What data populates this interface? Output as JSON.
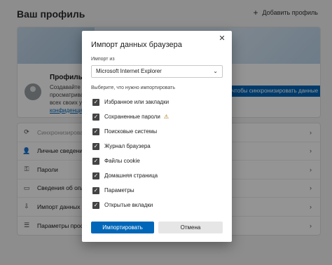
{
  "header": {
    "title": "Ваш профиль",
    "add_profile": "Добавить профиль"
  },
  "profile": {
    "name": "Профиль 1",
    "desc_lines": [
      "Создавайте",
      "просматрива",
      "всех своих у"
    ],
    "link": "конфиденци",
    "sync_button": "чтобы синхронизировать данные"
  },
  "settings": {
    "items": [
      {
        "label": "Синхронизироват",
        "icon": "sync-icon"
      },
      {
        "label": "Личные сведения",
        "icon": "person-icon"
      },
      {
        "label": "Пароли",
        "icon": "key-icon"
      },
      {
        "label": "Сведения об оплат",
        "icon": "card-icon"
      },
      {
        "label": "Импорт данных бр",
        "icon": "import-icon"
      },
      {
        "label": "Параметры профил",
        "icon": "profile-settings-icon"
      }
    ]
  },
  "dialog": {
    "title": "Импорт данных браузера",
    "close_icon": "close-icon",
    "import_from_label": "Импорт из",
    "import_from_value": "Microsoft Internet Explorer",
    "choose_label": "Выберите, что нужно импортировать",
    "options": [
      {
        "label": "Избранное или закладки",
        "checked": true
      },
      {
        "label": "Сохраненные пароли",
        "checked": true,
        "warning": true
      },
      {
        "label": "Поисковые системы",
        "checked": true
      },
      {
        "label": "Журнал браузера",
        "checked": true
      },
      {
        "label": "Файлы cookie",
        "checked": true
      },
      {
        "label": "Домашняя страница",
        "checked": true
      },
      {
        "label": "Параметры",
        "checked": true
      },
      {
        "label": "Открытые вкладки",
        "checked": true
      }
    ],
    "import_button": "Импортировать",
    "cancel_button": "Отмена"
  },
  "colors": {
    "accent": "#0067b8",
    "warning": "#a36a00"
  }
}
